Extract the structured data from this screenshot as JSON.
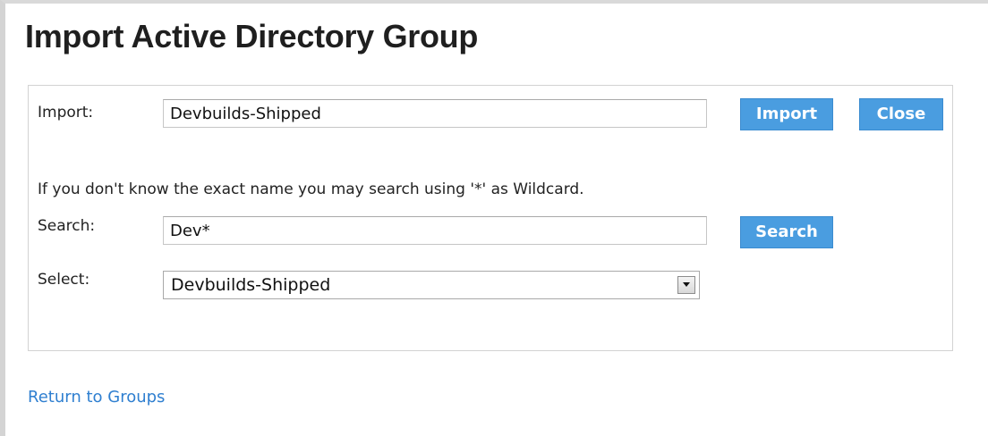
{
  "page": {
    "title": "Import Active Directory Group"
  },
  "import_row": {
    "label": "Import:",
    "value": "Devbuilds-Shipped",
    "import_button": "Import",
    "close_button": "Close"
  },
  "hint_text": "If you don't know the exact name you may search using '*' as Wildcard.",
  "search_row": {
    "label": "Search:",
    "value": "Dev*",
    "search_button": "Search"
  },
  "select_row": {
    "label": "Select:",
    "selected": "Devbuilds-Shipped",
    "options": [
      "Devbuilds-Shipped"
    ]
  },
  "footer": {
    "return_link": "Return to Groups"
  },
  "colors": {
    "button_bg": "#4a9de0",
    "link": "#2f7fd0",
    "title": "#1f1f1f"
  }
}
